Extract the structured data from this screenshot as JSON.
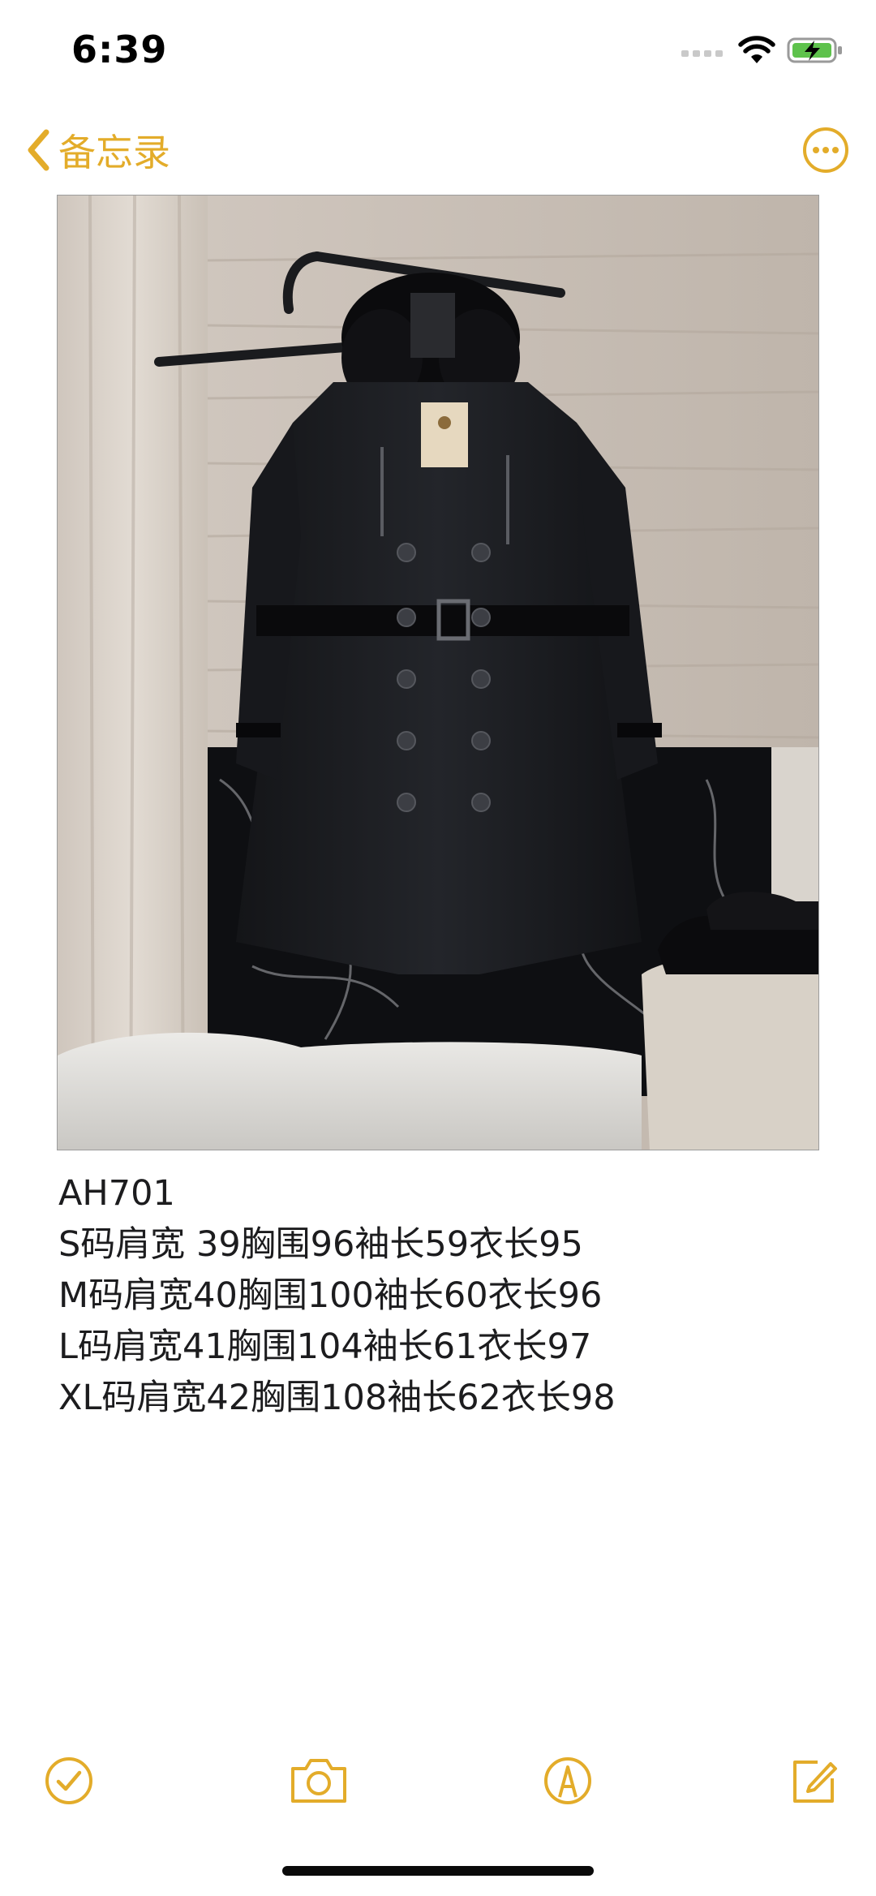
{
  "status_bar": {
    "time": "6:39"
  },
  "nav": {
    "back_label": "备忘录",
    "back_icon": "chevron-left-icon",
    "more_icon": "ellipsis-circle-icon"
  },
  "note": {
    "image_description_icon": "photo-attachment",
    "lines": [
      "AH701",
      "S码肩宽 39胸围96袖长59衣长95",
      "M码肩宽40胸围100袖长60衣长96",
      "L码肩宽41胸围104袖长61衣长97",
      "XL码肩宽42胸围108袖长62衣长98"
    ]
  },
  "toolbar": {
    "checklist_icon": "checklist-icon",
    "camera_icon": "camera-icon",
    "markup_icon": "markup-pen-icon",
    "compose_icon": "compose-icon"
  },
  "colors": {
    "accent": "#e3ac2a",
    "text": "#1c1c1e",
    "background": "#ffffff"
  }
}
